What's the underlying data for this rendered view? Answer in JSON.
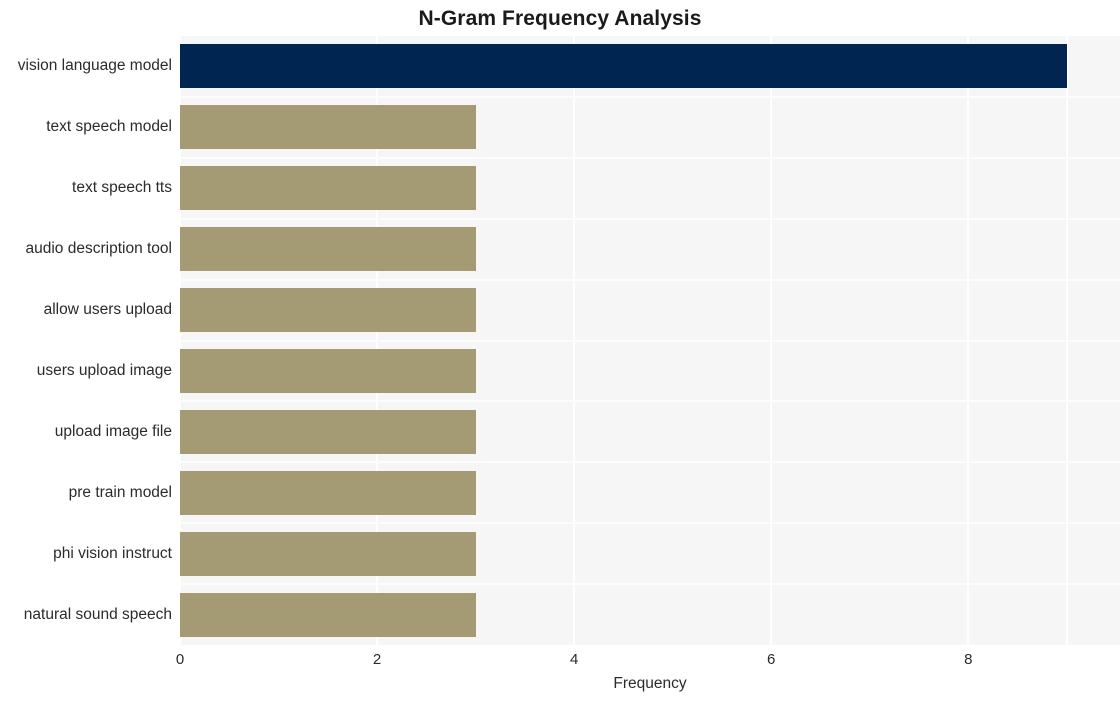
{
  "chart_data": {
    "type": "bar",
    "orientation": "horizontal",
    "title": "N-Gram Frequency Analysis",
    "xlabel": "Frequency",
    "ylabel": "",
    "categories": [
      "vision language model",
      "text speech model",
      "text speech tts",
      "audio description tool",
      "allow users upload",
      "users upload image",
      "upload image file",
      "pre train model",
      "phi vision instruct",
      "natural sound speech"
    ],
    "values": [
      9,
      3,
      3,
      3,
      3,
      3,
      3,
      3,
      3,
      3
    ],
    "xlim": [
      0,
      9.54
    ],
    "ylim": [
      0,
      10
    ],
    "xticks": [
      0,
      2,
      4,
      6,
      8
    ],
    "xtick_labels": [
      "0",
      "2",
      "4",
      "6",
      "8"
    ],
    "grid": true,
    "grid_axis": "x",
    "legend": false,
    "bar_colors": [
      "#002550",
      "#a49a74",
      "#a49a74",
      "#a49a74",
      "#a49a74",
      "#a49a74",
      "#a49a74",
      "#a49a74",
      "#a49a74",
      "#a49a74"
    ],
    "plot_background": "#f6f6f7",
    "gridline_color": "#ffffff",
    "figure_background": "#ffffff",
    "title_color": "#1a1a1a",
    "tick_color": "#2b2b2b"
  }
}
